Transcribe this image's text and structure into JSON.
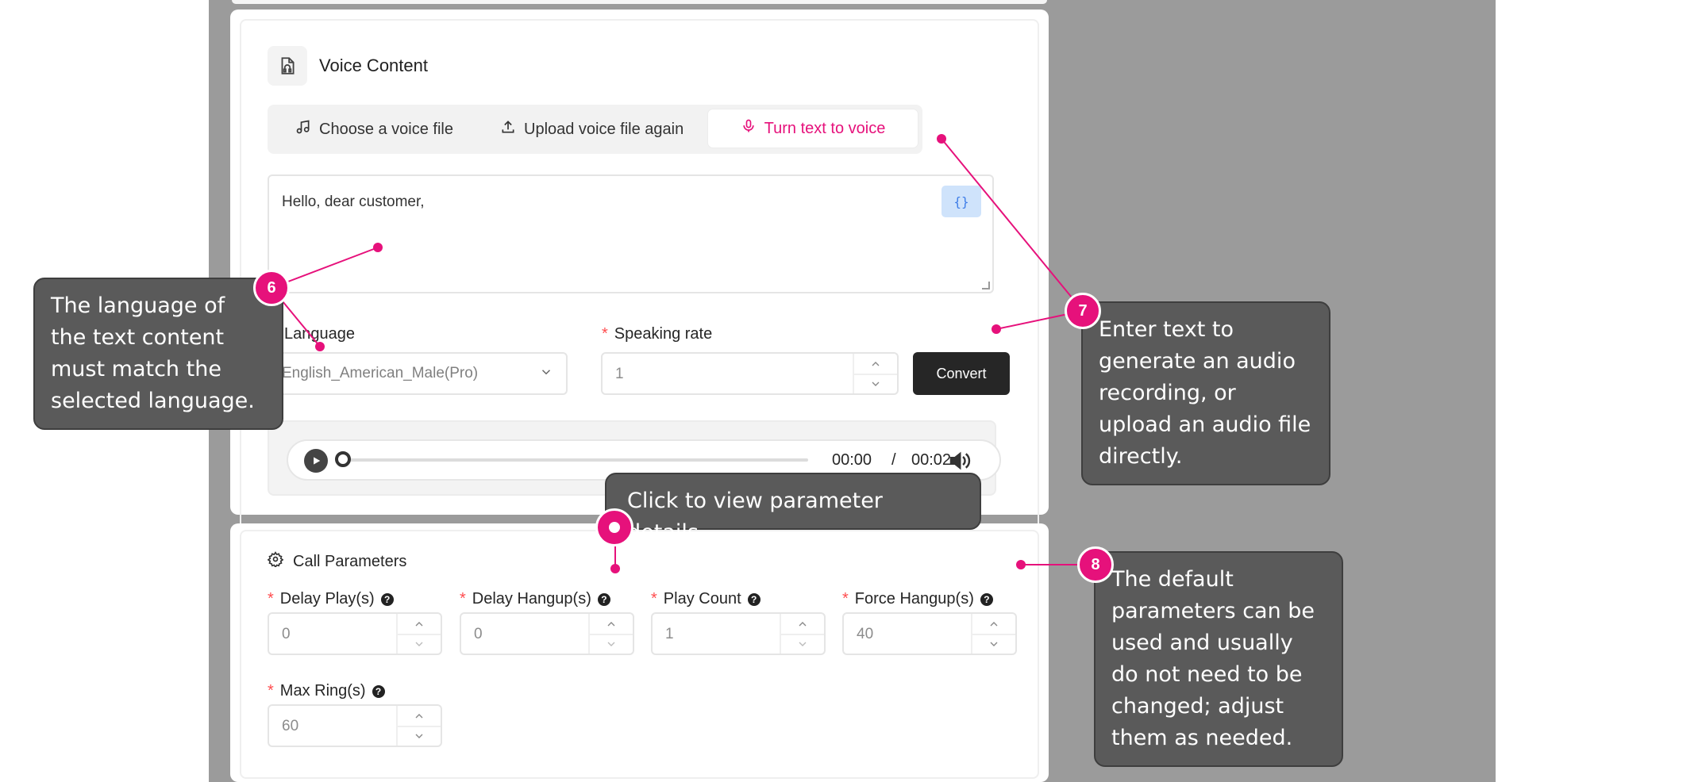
{
  "voice_content": {
    "title": "Voice Content",
    "tabs": [
      {
        "label": "Choose a voice file",
        "icon": "music-note-icon",
        "active": false
      },
      {
        "label": "Upload voice file again",
        "icon": "upload-icon",
        "active": false
      },
      {
        "label": "Turn text to voice",
        "icon": "microphone-icon",
        "active": true
      }
    ],
    "text_value": "Hello, dear customer,",
    "variable_button": "{}",
    "language_label": "Language",
    "language_value": "English_American_Male(Pro)",
    "speaking_rate_label": "Speaking rate",
    "speaking_rate_value": "1",
    "convert_label": "Convert",
    "player": {
      "current": "00:00",
      "separator": "/",
      "duration": "00:02",
      "progress": 0
    }
  },
  "call_parameters": {
    "title": "Call Parameters",
    "fields": [
      {
        "label": "Delay Play(s)",
        "value": "0"
      },
      {
        "label": "Delay Hangup(s)",
        "value": "0"
      },
      {
        "label": "Play Count",
        "value": "1"
      },
      {
        "label": "Force Hangup(s)",
        "value": "40"
      },
      {
        "label": "Max Ring(s)",
        "value": "60"
      }
    ]
  },
  "annotations": {
    "note6": {
      "badge": "6",
      "text": "The language of the text content must match the selected language."
    },
    "note7": {
      "badge": "7",
      "text": "Enter text to generate an audio recording, or upload an audio file directly."
    },
    "note8": {
      "badge": "8",
      "text": "The default parameters can be used and usually do not need to be changed; adjust them as needed."
    },
    "tooltip": {
      "text": "Click to view parameter details."
    }
  },
  "colors": {
    "accent": "#e6117b",
    "callout_bg": "#5a5a5a",
    "backdrop": "#9b9b9b",
    "primary_button": "#262626"
  }
}
